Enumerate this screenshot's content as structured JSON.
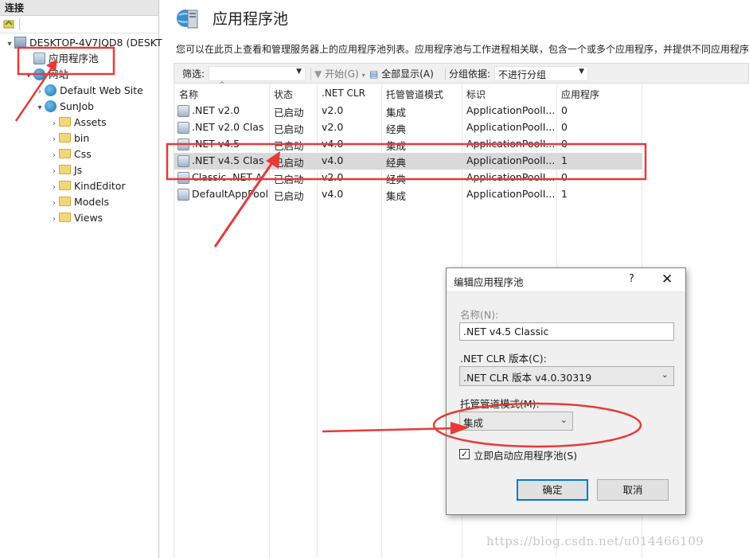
{
  "left_pane": {
    "header": "连接",
    "tree": [
      {
        "label": "DESKTOP-4V7JQD8 (DESKT",
        "icon": "server-icon",
        "arrow": "▾",
        "indent": 0
      },
      {
        "label": "应用程序池",
        "icon": "app-pool-icon",
        "arrow": "",
        "indent": 1
      },
      {
        "label": "网站",
        "icon": "globe-icon",
        "arrow": "▾",
        "indent": 1
      },
      {
        "label": "Default Web Site",
        "icon": "globe-icon",
        "arrow": "›",
        "indent": 2
      },
      {
        "label": "SunJob",
        "icon": "globe-icon",
        "arrow": "▾",
        "indent": 2
      },
      {
        "label": "Assets",
        "icon": "folder-icon",
        "arrow": "›",
        "indent": 3
      },
      {
        "label": "bin",
        "icon": "folder-icon",
        "arrow": "›",
        "indent": 3
      },
      {
        "label": "Css",
        "icon": "folder-icon",
        "arrow": "›",
        "indent": 3
      },
      {
        "label": "Js",
        "icon": "folder-icon",
        "arrow": "›",
        "indent": 3
      },
      {
        "label": "KindEditor",
        "icon": "folder-icon",
        "arrow": "›",
        "indent": 3
      },
      {
        "label": "Models",
        "icon": "folder-icon",
        "arrow": "›",
        "indent": 3
      },
      {
        "label": "Views",
        "icon": "folder-icon",
        "arrow": "›",
        "indent": 3
      }
    ]
  },
  "main": {
    "title": "应用程序池",
    "description": "您可以在此页上查看和管理服务器上的应用程序池列表。应用程序池与工作进程相关联，包含一个或多个应用程序，并提供不同应用程序",
    "filter_bar": {
      "filter_label": "筛选:",
      "filter_value": "",
      "start_label": "开始(G)",
      "show_all_label": "全部显示(A)",
      "group_by_label": "分组依据:",
      "group_by_value": "不进行分组"
    },
    "columns": [
      "名称",
      "状态",
      ".NET CLR",
      "托管管道模式",
      "标识",
      "应用程序"
    ],
    "rows": [
      {
        "name": ".NET v2.0",
        "status": "已启动",
        "clr": "v2.0",
        "mode": "集成",
        "identity": "ApplicationPoolI...",
        "apps": "0"
      },
      {
        "name": ".NET v2.0 Clas",
        "status": "已启动",
        "clr": "v2.0",
        "mode": "经典",
        "identity": "ApplicationPoolI...",
        "apps": "0"
      },
      {
        "name": ".NET v4.5",
        "status": "已启动",
        "clr": "v4.0",
        "mode": "集成",
        "identity": "ApplicationPoolI...",
        "apps": "0"
      },
      {
        "name": ".NET v4.5 Clas",
        "status": "已启动",
        "clr": "v4.0",
        "mode": "经典",
        "identity": "ApplicationPoolI...",
        "apps": "1"
      },
      {
        "name": "Classic .NET A",
        "status": "已启动",
        "clr": "v2.0",
        "mode": "经典",
        "identity": "ApplicationPoolI...",
        "apps": "0"
      },
      {
        "name": "DefaultAppPool",
        "status": "已启动",
        "clr": "v4.0",
        "mode": "集成",
        "identity": "ApplicationPoolI...",
        "apps": "1"
      }
    ],
    "selected_row": 3
  },
  "dialog": {
    "title": "编辑应用程序池",
    "help": "?",
    "close": "✕",
    "name_label": "名称(N):",
    "name_value": ".NET v4.5 Classic",
    "clr_label": ".NET CLR 版本(C):",
    "clr_value": ".NET CLR 版本 v4.0.30319",
    "pipeline_label": "托管管道模式(M):",
    "pipeline_value": "集成",
    "start_checkbox_label": "立即启动应用程序池(S)",
    "start_checked": true,
    "ok_label": "确定",
    "cancel_label": "取消"
  },
  "watermark": "https://blog.csdn.net/u014466109",
  "colors": {
    "annotation_red": "#e63a3a",
    "selection": "#d9d9d9",
    "focus_blue": "#0078d7"
  }
}
